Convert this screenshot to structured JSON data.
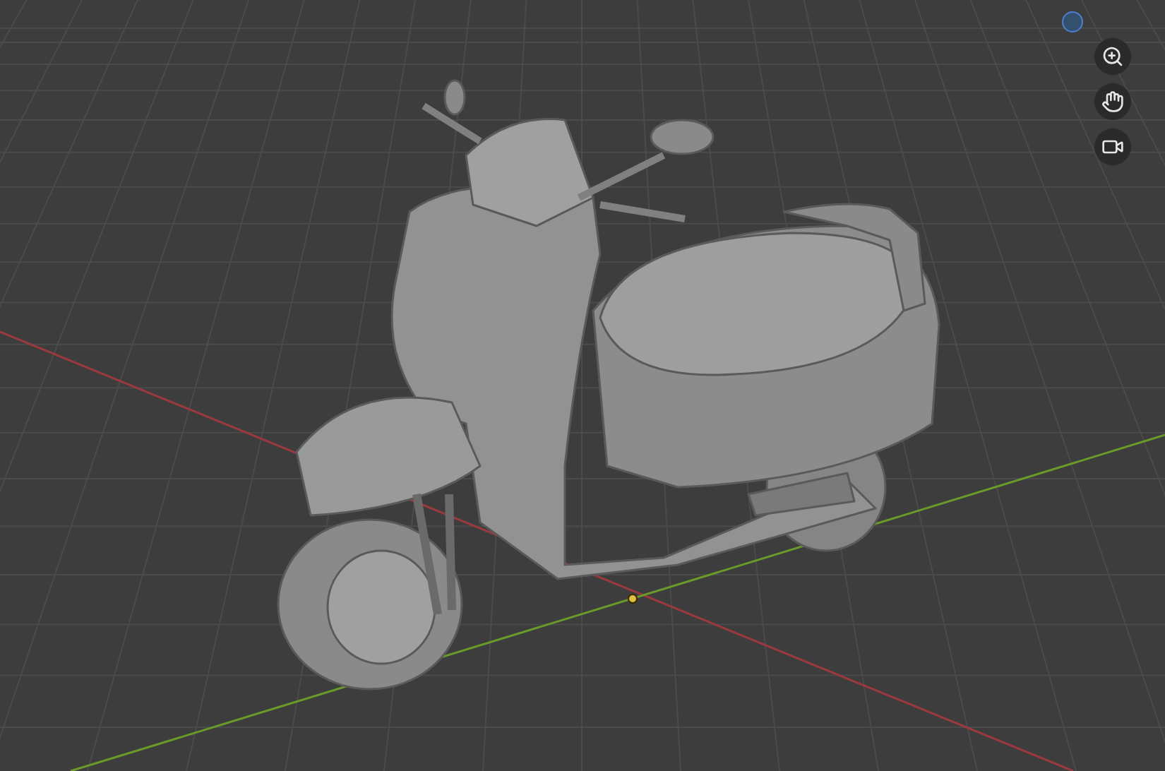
{
  "viewport": {
    "tools": [
      {
        "kind": "zoom"
      },
      {
        "kind": "pan"
      },
      {
        "kind": "camera"
      }
    ]
  }
}
